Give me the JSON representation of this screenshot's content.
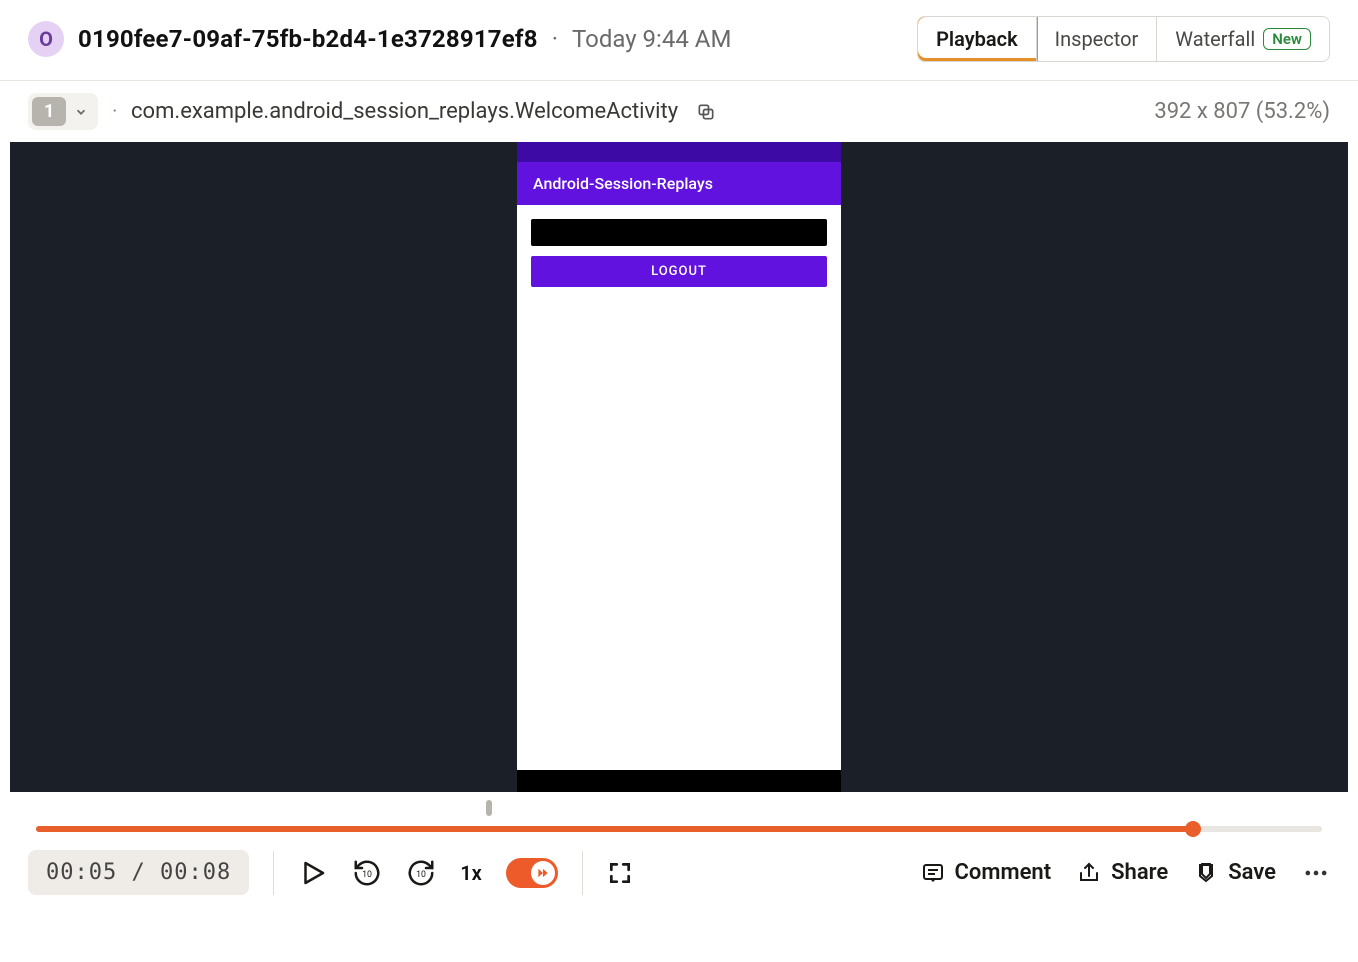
{
  "header": {
    "avatar_initial": "O",
    "session_id": "0190fee7-09af-75fb-b2d4-1e3728917ef8",
    "timestamp": "Today 9:44 AM",
    "tabs": {
      "playback": "Playback",
      "inspector": "Inspector",
      "waterfall": "Waterfall",
      "new_badge": "New"
    }
  },
  "subheader": {
    "frame_count": "1",
    "activity": "com.example.android_session_replays.WelcomeActivity",
    "viewport": "392 x 807 (53.2%)"
  },
  "device": {
    "app_title": "Android-Session-Replays",
    "logout_label": "LOGOUT"
  },
  "timeline": {
    "marker_pct": 35,
    "buffered_pct": 4,
    "played_pct": 90,
    "playhead_pct": 90
  },
  "playback": {
    "current_time": "00:05",
    "total_time": "00:08",
    "speed": "1x"
  },
  "actions": {
    "comment": "Comment",
    "share": "Share",
    "save": "Save"
  }
}
